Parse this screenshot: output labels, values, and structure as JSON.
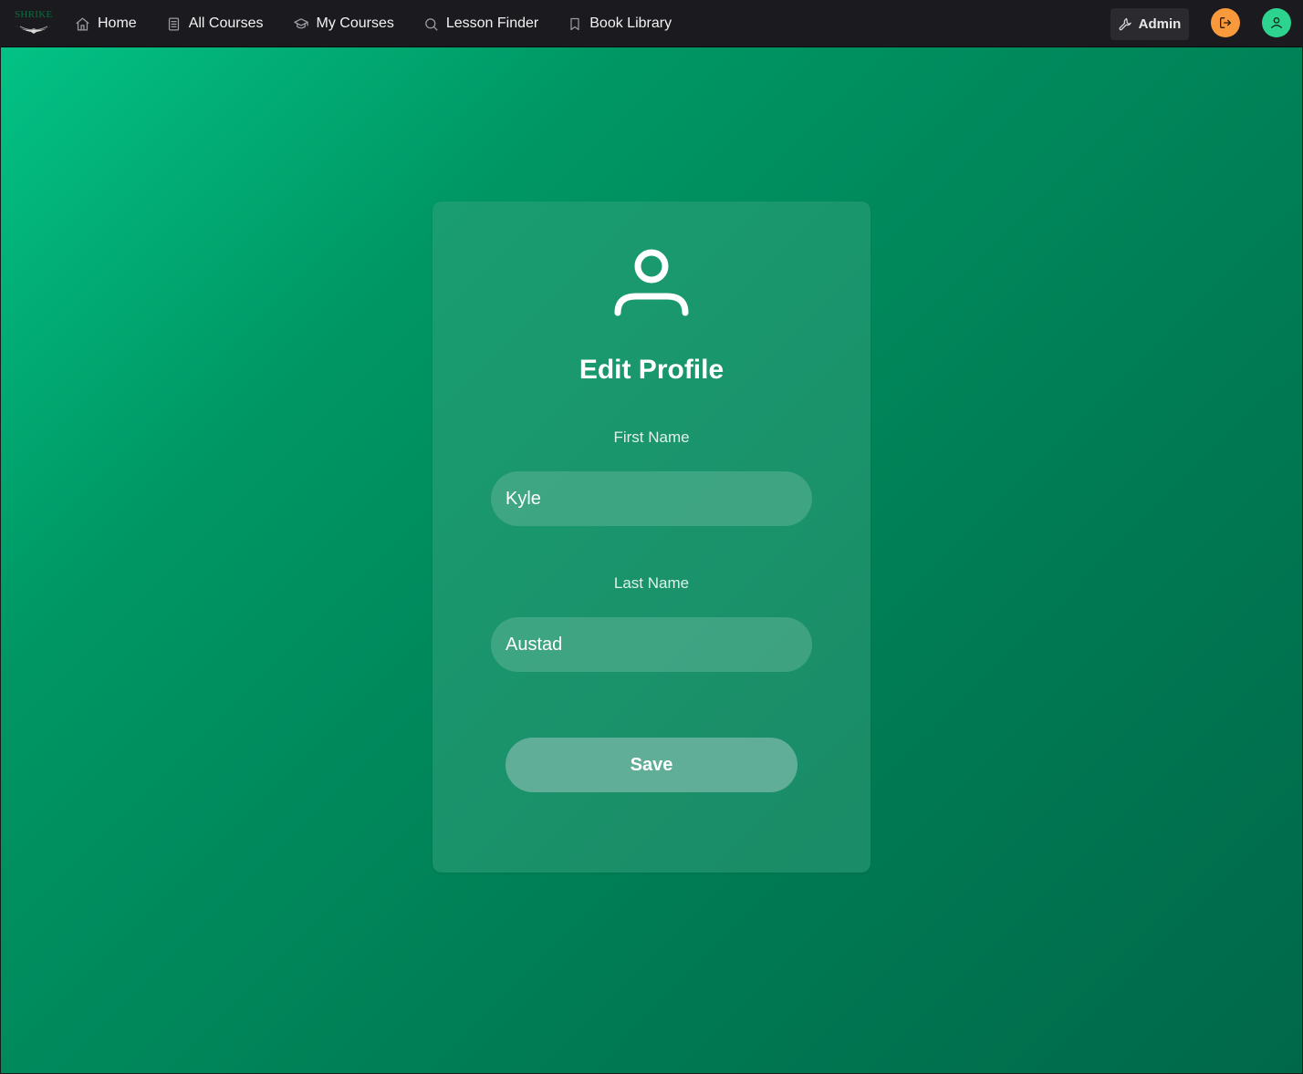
{
  "brand": {
    "logo_text": "SHRIKE"
  },
  "nav": {
    "items": [
      {
        "label": "Home",
        "icon": "home-icon"
      },
      {
        "label": "All Courses",
        "icon": "document-icon"
      },
      {
        "label": "My Courses",
        "icon": "graduation-cap-icon"
      },
      {
        "label": "Lesson Finder",
        "icon": "search-icon"
      },
      {
        "label": "Book Library",
        "icon": "bookmark-icon"
      }
    ],
    "admin_label": "Admin",
    "admin_icon": "wrench-icon",
    "logout_icon": "logout-icon",
    "user_icon": "user-icon"
  },
  "colors": {
    "accent_orange": "#f89a3c",
    "accent_green": "#2dd48f",
    "navbar_bg": "#1b1b1f"
  },
  "profile_form": {
    "icon": "user-profile-icon",
    "title": "Edit Profile",
    "first_name_label": "First Name",
    "first_name_value": "Kyle",
    "last_name_label": "Last Name",
    "last_name_value": "Austad",
    "save_label": "Save"
  }
}
